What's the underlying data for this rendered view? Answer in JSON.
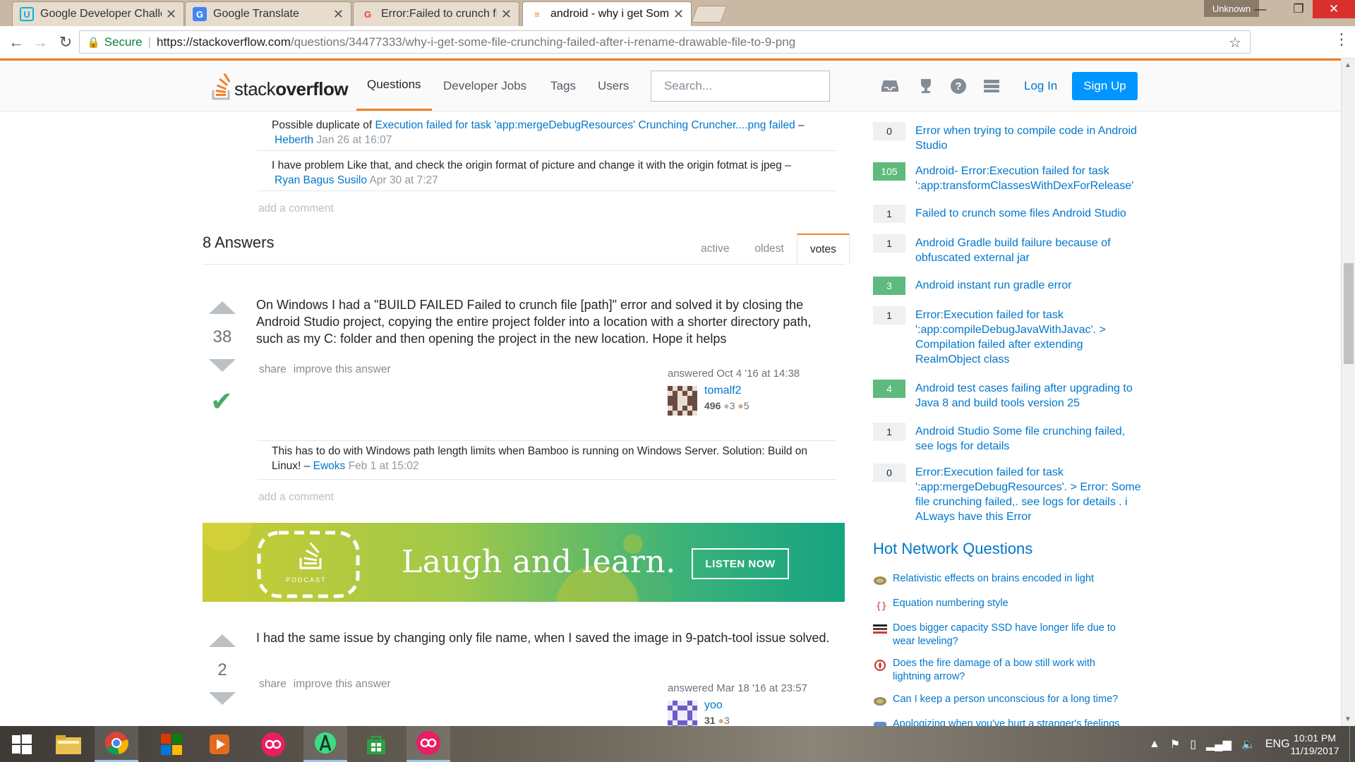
{
  "browser": {
    "tabs": [
      {
        "title": "Google Developer Challe",
        "icon": "udacity-icon",
        "color": "#02b3e4"
      },
      {
        "title": "Google Translate",
        "icon": "translate-icon",
        "color": "#4285f4"
      },
      {
        "title": "Error:Failed to crunch file",
        "icon": "google-icon",
        "color": "#ea4335"
      },
      {
        "title": "android - why i get Some",
        "icon": "stackoverflow-icon",
        "color": "#f48024"
      }
    ],
    "profile": "Unknown",
    "secure_label": "Secure",
    "url_host": "https://stackoverflow.com",
    "url_path": "/questions/34477333/why-i-get-some-file-crunching-failed-after-i-rename-drawable-file-to-9-png"
  },
  "header": {
    "logo_plain": "stack",
    "logo_bold": "overflow",
    "nav": [
      "Questions",
      "Developer Jobs",
      "Tags",
      "Users"
    ],
    "search_placeholder": "Search...",
    "login": "Log In",
    "signup": "Sign Up"
  },
  "question_comments": [
    {
      "prefix": "Possible duplicate of ",
      "link": "Execution failed for task 'app:mergeDebugResources' Crunching Cruncher....png failed",
      "dash": " – ",
      "user": "Heberth",
      "date": "Jan 26 at 16:07"
    },
    {
      "prefix": "I have problem Like that, and check the origin format of picture and change it with the origin fotmat is jpeg – ",
      "link": "",
      "dash": "",
      "user": "Ryan Bagus Susilo",
      "date": "Apr 30 at 7:27"
    }
  ],
  "add_comment": "add a comment",
  "answers_header": {
    "title": "8 Answers",
    "sort_tabs": [
      "active",
      "oldest",
      "votes"
    ],
    "active_tab": "votes"
  },
  "answers": [
    {
      "votes": "38",
      "accepted": true,
      "text": "On Windows I had a \"BUILD FAILED Failed to crunch file [path]\" error and solved it by closing the Android Studio project, copying the entire project folder into a location with a shorter directory path, such as my C: folder and then opening the project in the new location. Hope it helps",
      "share": "share",
      "improve": "improve this answer",
      "answered": "answered Oct 4 '16 at 14:38",
      "user": "tomalf2",
      "rep": "496",
      "silver": "3",
      "bronze": "5",
      "comment": {
        "text": "This has to do with Windows path length limits when Bamboo is running on Windows Server. Solution: Build on Linux! – ",
        "user": "Ewoks",
        "date": "Feb 1 at 15:02"
      }
    },
    {
      "votes": "2",
      "accepted": false,
      "text": "I had the same issue by changing only file name, when I saved the image in 9-patch-tool issue solved.",
      "share": "share",
      "improve": "improve this answer",
      "answered": "answered Mar 18 '16 at 23:57",
      "user": "yoo",
      "rep": "31",
      "bronze": "3"
    }
  ],
  "banner": {
    "text": "Laugh and learn.",
    "button": "LISTEN NOW",
    "podcast_label": "PODCAST"
  },
  "related": [
    {
      "count": "0",
      "accepted": false,
      "title": "Error when trying to compile code in Android Studio"
    },
    {
      "count": "105",
      "accepted": true,
      "title": "Android- Error:Execution failed for task ':app:transformClassesWithDexForRelease'"
    },
    {
      "count": "1",
      "accepted": false,
      "title": "Failed to crunch some files Android Studio"
    },
    {
      "count": "1",
      "accepted": false,
      "title": "Android Gradle build failure because of obfuscated external jar"
    },
    {
      "count": "3",
      "accepted": true,
      "title": "Android instant run gradle error"
    },
    {
      "count": "1",
      "accepted": false,
      "title": "Error:Execution failed for task ':app:compileDebugJavaWithJavac'. > Compilation failed after extending RealmObject class"
    },
    {
      "count": "4",
      "accepted": true,
      "title": "Android test cases failing after upgrading to Java 8 and build tools version 25"
    },
    {
      "count": "1",
      "accepted": false,
      "title": "Android Studio Some file crunching failed, see logs for details"
    },
    {
      "count": "0",
      "accepted": false,
      "title": "Error:Execution failed for task ':app:mergeDebugResources'. > Error: Some file crunching failed,. see logs for details . i ALways have this Error"
    }
  ],
  "hnq": {
    "title": "Hot Network Questions",
    "items": [
      {
        "title": "Relativistic effects on brains encoded in light",
        "icon": "worldbuilding-icon"
      },
      {
        "title": "Equation numbering style",
        "icon": "tex-icon"
      },
      {
        "title": "Does bigger capacity SSD have longer life due to wear leveling?",
        "icon": "superuser-icon"
      },
      {
        "title": "Does the fire damage of a bow still work with lightning arrow?",
        "icon": "arqade-icon"
      },
      {
        "title": "Can I keep a person unconscious for a long time?",
        "icon": "worldbuilding-icon"
      },
      {
        "title": "Apologizing when you've hurt a stranger's feelings",
        "icon": "interpersonal-icon"
      }
    ]
  },
  "taskbar": {
    "apps": [
      "windows-start-icon",
      "file-explorer-icon",
      "chrome-icon",
      "office-icon",
      "media-player-icon",
      "flickr-app-icon",
      "android-studio-icon",
      "store-icon",
      "flickr-app-icon"
    ],
    "language": "ENG",
    "time": "10:01 PM",
    "date": "11/19/2017"
  }
}
